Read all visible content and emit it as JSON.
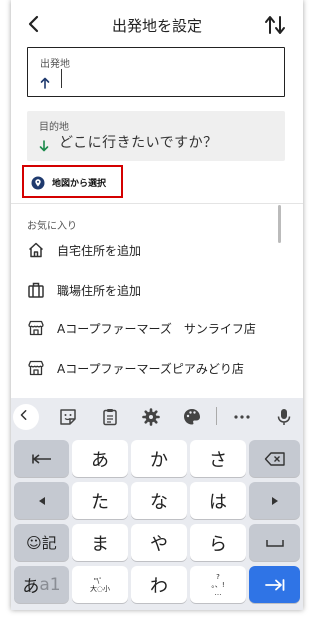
{
  "header": {
    "title": "出発地を設定"
  },
  "origin": {
    "label": "出発地",
    "value": ""
  },
  "destination": {
    "label": "目的地",
    "placeholder": "どこに行きたいですか？"
  },
  "map_select": {
    "label": "地図から選択"
  },
  "favorites": {
    "header": "お気に入り",
    "items": [
      {
        "label": "自宅住所を追加",
        "icon": "home-icon"
      },
      {
        "label": "職場住所を追加",
        "icon": "briefcase-icon"
      },
      {
        "label": "Aコープファーマーズ　サンライフ店",
        "icon": "store-icon"
      },
      {
        "label": "Aコープファーマーズピアみどり店",
        "icon": "store-icon"
      }
    ]
  },
  "keyboard": {
    "toolbar": [
      "back-icon",
      "emoji-sticker-icon",
      "clipboard-icon",
      "settings-icon",
      "palette-icon",
      "more-icon",
      "mic-icon"
    ],
    "row1": [
      "あ",
      "か",
      "さ"
    ],
    "row2": [
      "た",
      "な",
      "は"
    ],
    "row3": [
      "ま",
      "や",
      "ら"
    ],
    "row4": [
      "わ"
    ],
    "emoji_key": "☺記",
    "mode_key_a": "あ",
    "mode_key_b": "a1",
    "small_key_top": "\"\\゜",
    "small_key_bottom": "大◌小",
    "punct_top": "?",
    "punct_mid": "。、!",
    "punct_bottom": "…",
    "accent_color": "#2f74e6",
    "highlight_color": "#d40000"
  }
}
